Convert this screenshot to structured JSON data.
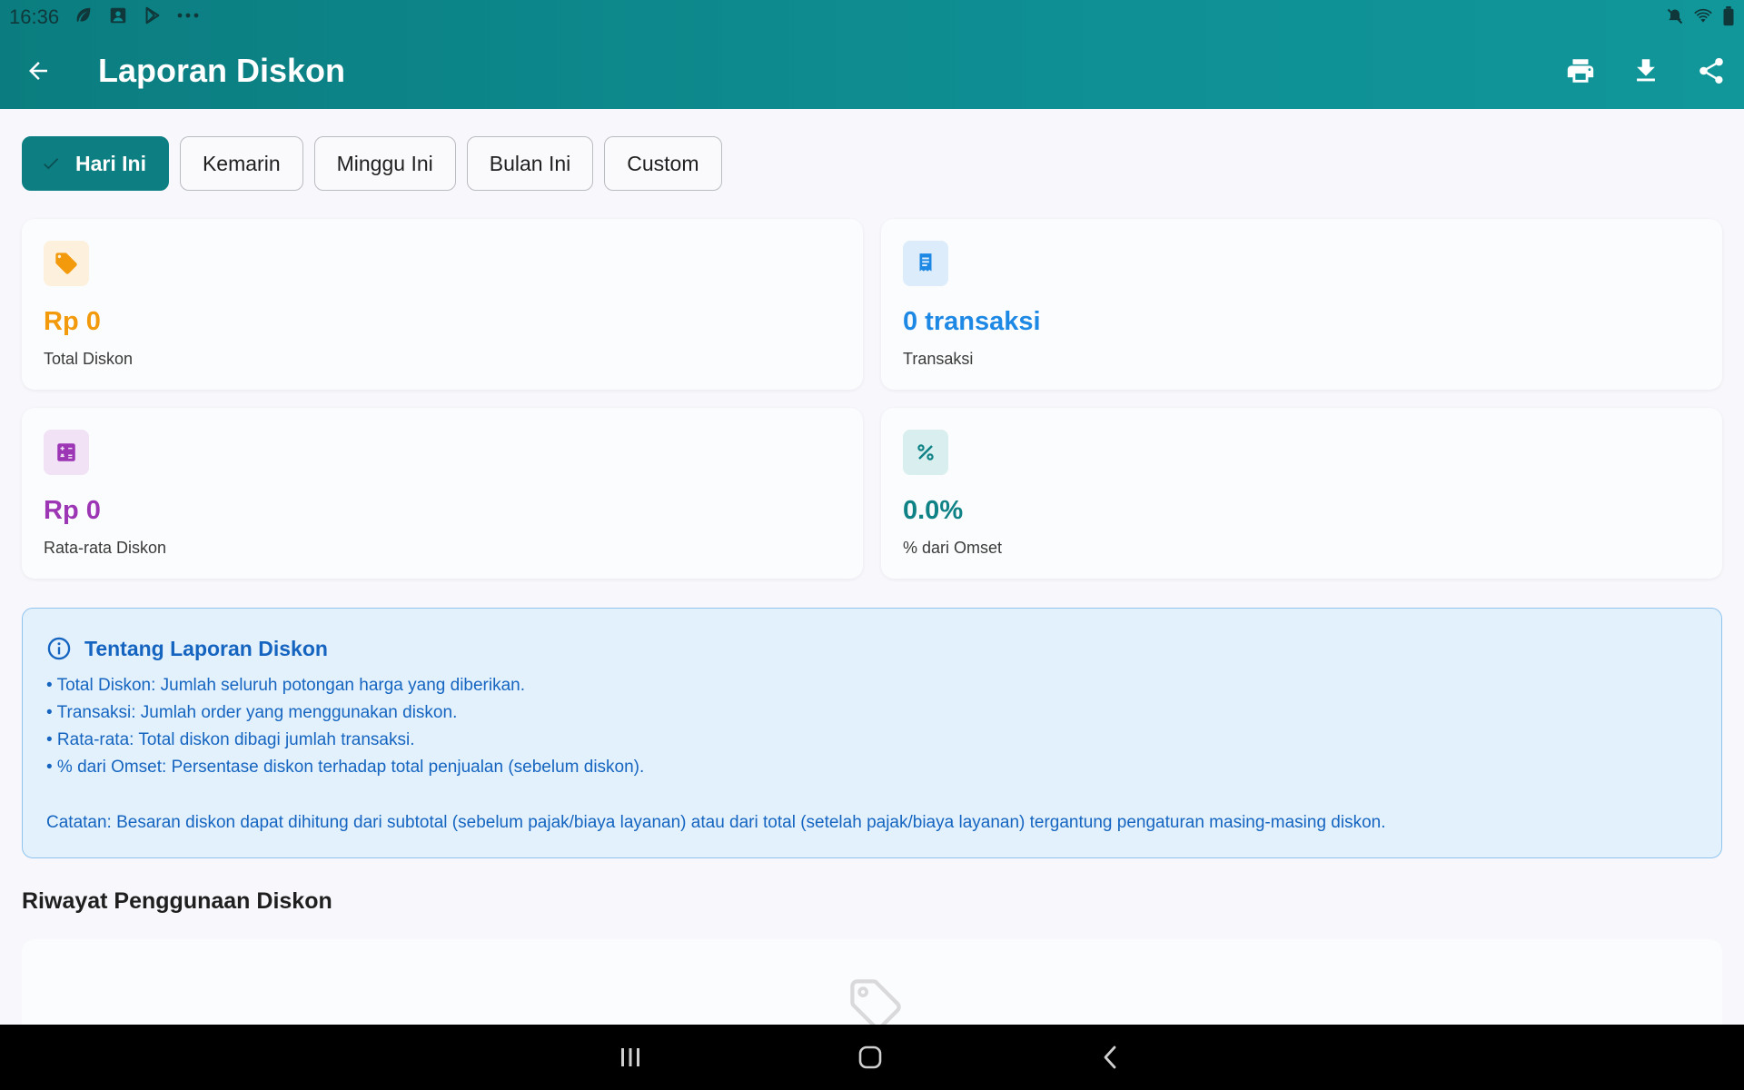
{
  "status_bar": {
    "time": "16:36",
    "left_icons": [
      "leaf-icon",
      "photo-icon",
      "play-store-icon",
      "more-dots-icon"
    ],
    "right_icons": [
      "mute-icon",
      "wifi-icon",
      "battery-icon"
    ]
  },
  "app_bar": {
    "title": "Laporan Diskon",
    "actions": [
      "print-icon",
      "download-icon",
      "share-icon"
    ]
  },
  "filters": {
    "chips": [
      {
        "label": "Hari Ini",
        "selected": true
      },
      {
        "label": "Kemarin",
        "selected": false
      },
      {
        "label": "Minggu Ini",
        "selected": false
      },
      {
        "label": "Bulan Ini",
        "selected": false
      },
      {
        "label": "Custom",
        "selected": false
      }
    ]
  },
  "stats": [
    {
      "icon": "tag-icon",
      "value": "Rp 0",
      "label": "Total Diskon",
      "color": "#f29a0b",
      "bg": "#fdf0dc"
    },
    {
      "icon": "receipt-icon",
      "value": "0 transaksi",
      "label": "Transaksi",
      "color": "#1e88e5",
      "bg": "#dcecfb"
    },
    {
      "icon": "calculator-icon",
      "value": "Rp 0",
      "label": "Rata-rata Diskon",
      "color": "#9c36b5",
      "bg": "#f1e2f5"
    },
    {
      "icon": "percent-icon",
      "value": "0.0%",
      "label": "% dari Omset",
      "color": "#0f8286",
      "bg": "#d9eeee"
    }
  ],
  "info": {
    "title": "Tentang Laporan Diskon",
    "lines": [
      "• Total Diskon: Jumlah seluruh potongan harga yang diberikan.",
      "• Transaksi: Jumlah order yang menggunakan diskon.",
      "• Rata-rata: Total diskon dibagi jumlah transaksi.",
      "• % dari Omset: Persentase diskon terhadap total penjualan (sebelum diskon)."
    ],
    "note": "Catatan: Besaran diskon dapat dihitung dari subtotal (sebelum pajak/biaya layanan) atau dari total (setelah pajak/biaya layanan) tergantung pengaturan masing-masing diskon."
  },
  "history": {
    "title": "Riwayat Penggunaan Diskon",
    "empty_icon": "tag-outline-icon"
  },
  "nav_bar": {
    "buttons": [
      "recents-icon",
      "home-icon",
      "back-nav-icon"
    ]
  },
  "colors": {
    "primary": "#0d7f82",
    "info_text": "#1565c0",
    "info_bg": "#e3f1fd"
  }
}
